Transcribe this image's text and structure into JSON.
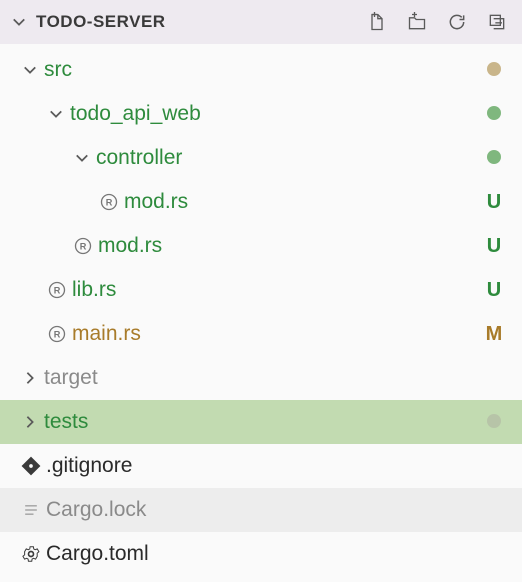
{
  "header": {
    "title": "TODO-SERVER",
    "actions": {
      "new_file": "new-file",
      "new_folder": "new-folder",
      "refresh": "refresh",
      "collapse_all": "collapse-all"
    }
  },
  "tree": [
    {
      "id": "src",
      "label": "src",
      "kind": "folder",
      "depth": 0,
      "expanded": true,
      "color": "green",
      "status": {
        "type": "dot",
        "variant": "tan"
      }
    },
    {
      "id": "todo_api_web",
      "label": "todo_api_web",
      "kind": "folder",
      "depth": 1,
      "expanded": true,
      "color": "green",
      "status": {
        "type": "dot",
        "variant": "green"
      }
    },
    {
      "id": "controller",
      "label": "controller",
      "kind": "folder",
      "depth": 2,
      "expanded": true,
      "color": "green",
      "status": {
        "type": "dot",
        "variant": "green"
      }
    },
    {
      "id": "controller_mod",
      "label": "mod.rs",
      "kind": "rust",
      "depth": 3,
      "color": "green",
      "status": {
        "type": "letter",
        "value": "U",
        "variant": "u"
      }
    },
    {
      "id": "todo_api_web_mod",
      "label": "mod.rs",
      "kind": "rust",
      "depth": 2,
      "color": "green",
      "status": {
        "type": "letter",
        "value": "U",
        "variant": "u"
      }
    },
    {
      "id": "lib",
      "label": "lib.rs",
      "kind": "rust",
      "depth": 1,
      "color": "green",
      "status": {
        "type": "letter",
        "value": "U",
        "variant": "u"
      }
    },
    {
      "id": "main",
      "label": "main.rs",
      "kind": "rust",
      "depth": 1,
      "color": "olive",
      "status": {
        "type": "letter",
        "value": "M",
        "variant": "m"
      }
    },
    {
      "id": "target",
      "label": "target",
      "kind": "folder",
      "depth": 0,
      "expanded": false,
      "color": "muted"
    },
    {
      "id": "tests",
      "label": "tests",
      "kind": "folder",
      "depth": 0,
      "expanded": false,
      "color": "green",
      "selected": true,
      "status": {
        "type": "dot",
        "variant": "muted"
      }
    },
    {
      "id": "gitignore",
      "label": ".gitignore",
      "kind": "gitignore",
      "depth": 0,
      "color": "normal"
    },
    {
      "id": "cargolock",
      "label": "Cargo.lock",
      "kind": "file",
      "depth": 0,
      "color": "muted",
      "muted_bg": true
    },
    {
      "id": "cargotoml",
      "label": "Cargo.toml",
      "kind": "gear",
      "depth": 0,
      "color": "normal"
    }
  ],
  "icons": {
    "rust": "rust-icon",
    "gitignore": "gitignore-icon",
    "file": "file-icon",
    "gear": "gear-icon"
  }
}
